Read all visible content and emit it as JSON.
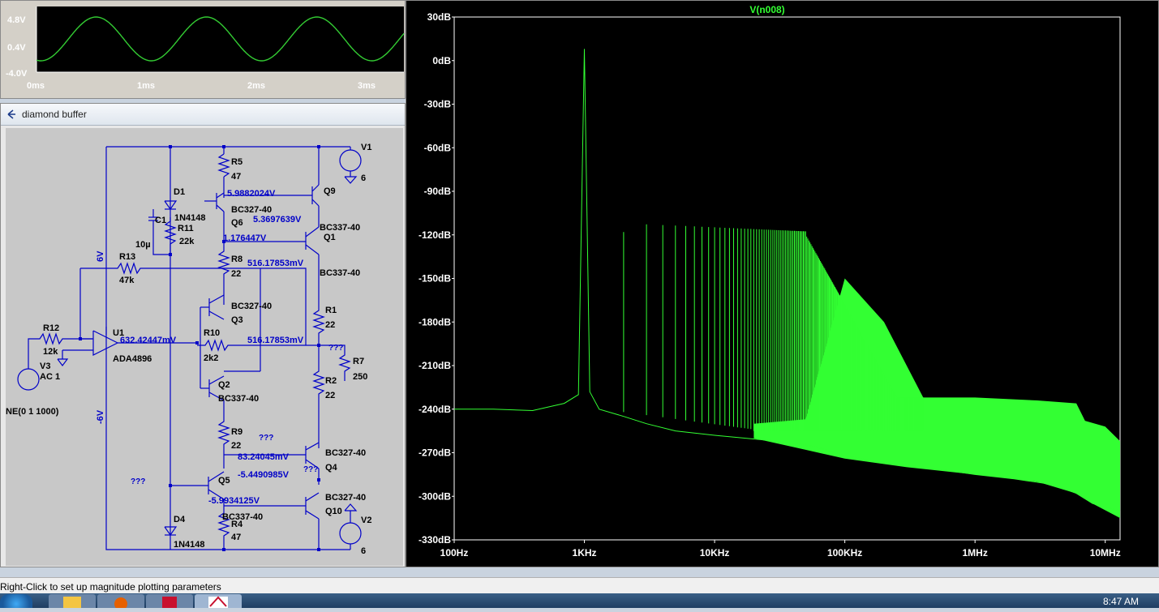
{
  "waveform": {
    "y_labels": [
      "4.8V",
      "0.4V",
      "-4.0V"
    ],
    "x_labels": [
      "0ms",
      "1ms",
      "2ms",
      "3ms"
    ],
    "color": "#33cc33"
  },
  "schematic": {
    "title": "diamond buffer",
    "components": {
      "V1": "V1",
      "V1_val": "6",
      "V2": "V2",
      "V2_val": "6",
      "V3": "V3",
      "V3_val": "AC 1",
      "V3_sine": "NE(0 1 1000)",
      "R5": "R5",
      "R5_val": "47",
      "R4": "R4",
      "R4_val": "47",
      "R11": "R11",
      "R11_val": "22k",
      "R13": "R13",
      "R13_val": "47k",
      "R12": "R12",
      "R12_val": "12k",
      "R8": "R8",
      "R8_val": "22",
      "R10": "R10",
      "R10_val": "2k2",
      "R9": "R9",
      "R9_val": "22",
      "R1": "R1",
      "R1_val": "22",
      "R2": "R2",
      "R2_val": "22",
      "R7": "R7",
      "R7_val": "250",
      "C1": "C1",
      "C1_val": "10µ",
      "D1": "D1",
      "D1_val": "1N4148",
      "D4": "D4",
      "D4_val": "1N4148",
      "U1": "U1",
      "U1_val": "ADA4896",
      "Q6": "Q6",
      "Q6_val": "BC327-40",
      "Q9": "Q9",
      "Q1": "Q1",
      "Q1_val": "BC337-40",
      "Q1_val2": "BC337-40",
      "Q3": "Q3",
      "Q3_val": "BC327-40",
      "Q2": "Q2",
      "Q2_val": "BC337-40",
      "Q5": "Q5",
      "Q5_val": "BC337-40",
      "Q4": "Q4",
      "Q4_val": "BC327-40",
      "Q10": "Q10",
      "Q10_val": "BC327-40"
    },
    "rails": {
      "pos": "6V",
      "neg": "-6V"
    },
    "voltages": {
      "v1": "5.9882024V",
      "v2": "5.3697639V",
      "v3": "1.176447V",
      "v4": "516.17853mV",
      "v5": "632.42447mV",
      "v6": "516.17853mV",
      "v7": "83.24045mV",
      "v8": "-5.4490985V",
      "v9": "-5.9934125V"
    },
    "unknown": "???"
  },
  "fft": {
    "title": "V(n008)",
    "y_labels": [
      "30dB",
      "0dB",
      "-30dB",
      "-60dB",
      "-90dB",
      "-120dB",
      "-150dB",
      "-180dB",
      "-210dB",
      "-240dB",
      "-270dB",
      "-300dB",
      "-330dB"
    ],
    "x_labels": [
      "100Hz",
      "1KHz",
      "10KHz",
      "100KHz",
      "1MHz",
      "10MHz"
    ],
    "color": "#33ff33"
  },
  "chart_data": {
    "type": "line",
    "title": "V(n008)",
    "xlabel": "",
    "ylabel": "",
    "x_scale": "log",
    "xlim": [
      100,
      13000000
    ],
    "ylim": [
      -330,
      30
    ],
    "x_ticks": [
      "100Hz",
      "1KHz",
      "10KHz",
      "100KHz",
      "1MHz",
      "10MHz"
    ],
    "y_ticks": [
      "30dB",
      "0dB",
      "-30dB",
      "-60dB",
      "-90dB",
      "-120dB",
      "-150dB",
      "-180dB",
      "-210dB",
      "-240dB",
      "-270dB",
      "-300dB",
      "-330dB"
    ],
    "series": [
      {
        "x": [
          100,
          200,
          400,
          700,
          900,
          1000,
          1100,
          1300,
          2000,
          3000,
          5000,
          10000,
          30000,
          60000,
          100000,
          200000,
          400000,
          700000,
          1000000,
          2000000,
          4000000,
          6000000,
          8000000,
          13000000
        ],
        "y": [
          -240,
          -240,
          -241,
          -236,
          -230,
          8,
          -228,
          -240,
          -245,
          -250,
          -255,
          -258,
          -262,
          -266,
          -272,
          -277,
          -280,
          -283,
          -285,
          -288,
          -292,
          -298,
          -305,
          -310
        ]
      }
    ],
    "harmonics_dB": [
      [
        1000,
        8
      ],
      [
        2000,
        -118
      ],
      [
        3000,
        -108
      ],
      [
        4000,
        -112
      ],
      [
        5000,
        -111
      ],
      [
        6000,
        -112
      ],
      [
        7000,
        -113
      ],
      [
        8000,
        -113
      ],
      [
        9000,
        -113
      ],
      [
        10000,
        -113
      ],
      [
        20000,
        -114
      ],
      [
        50000,
        -118
      ],
      [
        100000,
        -132
      ],
      [
        200000,
        -165
      ],
      [
        400000,
        -232
      ],
      [
        1000000,
        -232
      ],
      [
        6000000,
        -236
      ],
      [
        10000000,
        -248
      ],
      [
        13000000,
        -262
      ]
    ],
    "grid": false,
    "legend": "none"
  },
  "status": {
    "text": "Right-Click to set up magnitude plotting parameters"
  },
  "taskbar": {
    "clock": "8:47 AM"
  }
}
